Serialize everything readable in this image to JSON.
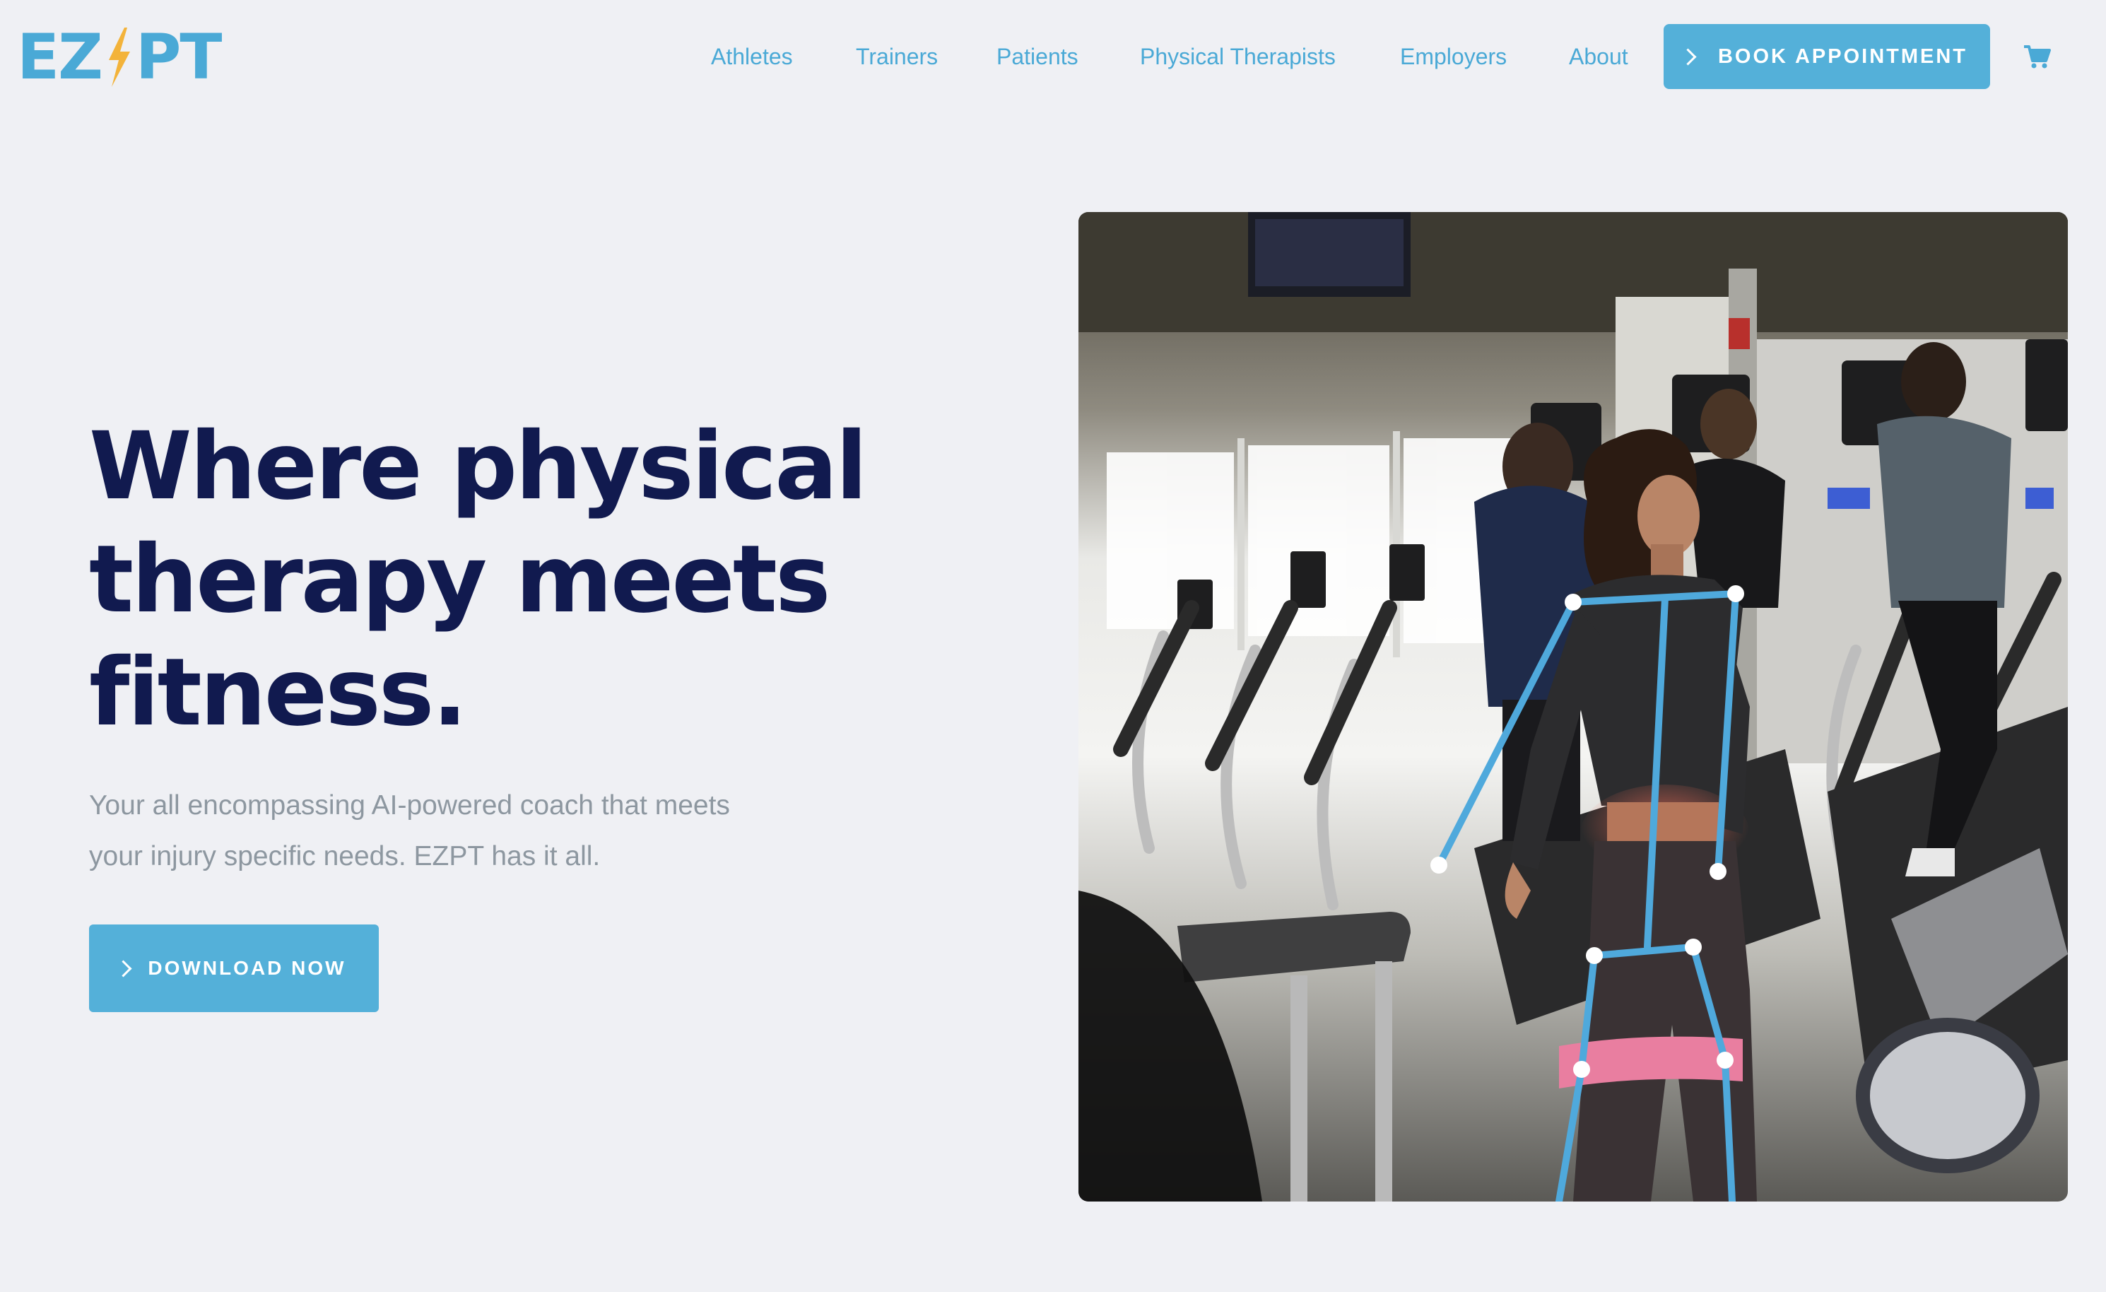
{
  "brand": {
    "logo_left": "EZ",
    "logo_right": "PT",
    "logo_color": "#4aa9d6",
    "bolt_color": "#f3b33a"
  },
  "nav": {
    "links": [
      "Athletes",
      "Trainers",
      "Patients",
      "Physical Therapists",
      "Employers",
      "About"
    ],
    "cta_label": "BOOK APPOINTMENT",
    "cart_icon": "shopping-cart-icon"
  },
  "hero": {
    "headline_lines": [
      "Where physical",
      "therapy meets",
      "fitness."
    ],
    "subtext_lines": [
      "Your all encompassing AI-powered coach that meets",
      "your injury specific needs. EZPT has it all."
    ],
    "button_label": "DOWNLOAD NOW"
  },
  "colors": {
    "accent": "#54b0d9",
    "headline": "#111a4f",
    "body_text": "#8d97a0",
    "background": "#eff0f4",
    "skeleton": "#4fa9dc"
  }
}
